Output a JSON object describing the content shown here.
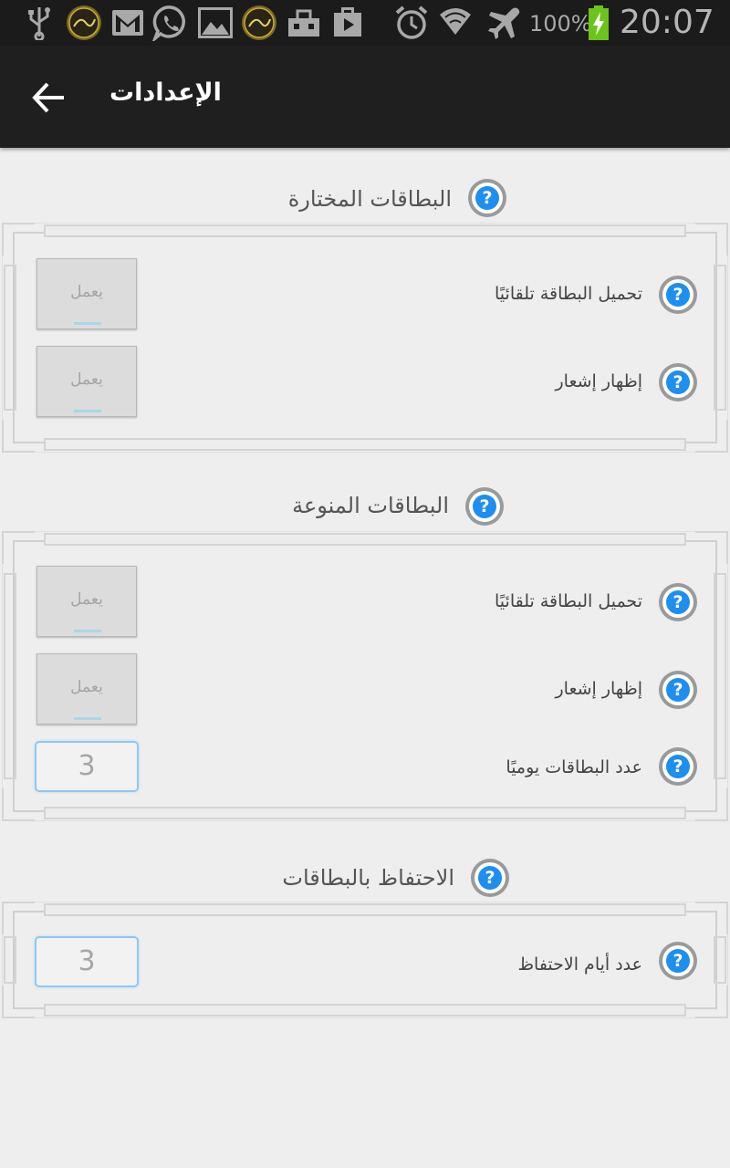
{
  "status_bar": {
    "battery_percent": "100%",
    "time": "20:07",
    "icons": [
      "usb-icon",
      "app-badge-icon",
      "gmail-icon",
      "whatsapp-icon",
      "gallery-icon",
      "app-badge-icon",
      "sim-toolkit-icon",
      "store-icon",
      "alarm-icon",
      "wifi-icon",
      "airplane-icon",
      "battery-charging-icon"
    ]
  },
  "app_bar": {
    "title": "الإعدادات",
    "back_icon": "arrow-left-icon"
  },
  "sections": [
    {
      "title": "البطاقات المختارة",
      "rows": [
        {
          "label": "تحميل البطاقة تلقائيًا",
          "control": "toggle",
          "value": "يعمل"
        },
        {
          "label": "إظهار إشعار",
          "control": "toggle",
          "value": "يعمل"
        }
      ]
    },
    {
      "title": "البطاقات المنوعة",
      "rows": [
        {
          "label": "تحميل البطاقة تلقائيًا",
          "control": "toggle",
          "value": "يعمل"
        },
        {
          "label": "إظهار إشعار",
          "control": "toggle",
          "value": "يعمل"
        },
        {
          "label": "عدد البطاقات يوميًا",
          "control": "number",
          "value": "3"
        }
      ]
    },
    {
      "title": "الاحتفاظ بالبطاقات",
      "rows": [
        {
          "label": "عدد أيام الاحتفاظ",
          "control": "number",
          "value": "3"
        }
      ]
    }
  ],
  "help_icon": "help-icon",
  "colors": {
    "status_bar": "#1b1b1b",
    "app_bar": "#1f1f1f",
    "background": "#eeeeee",
    "help_blue": "#1e8ef0",
    "input_border": "#8fc8f3",
    "battery_green": "#6bc41a"
  }
}
